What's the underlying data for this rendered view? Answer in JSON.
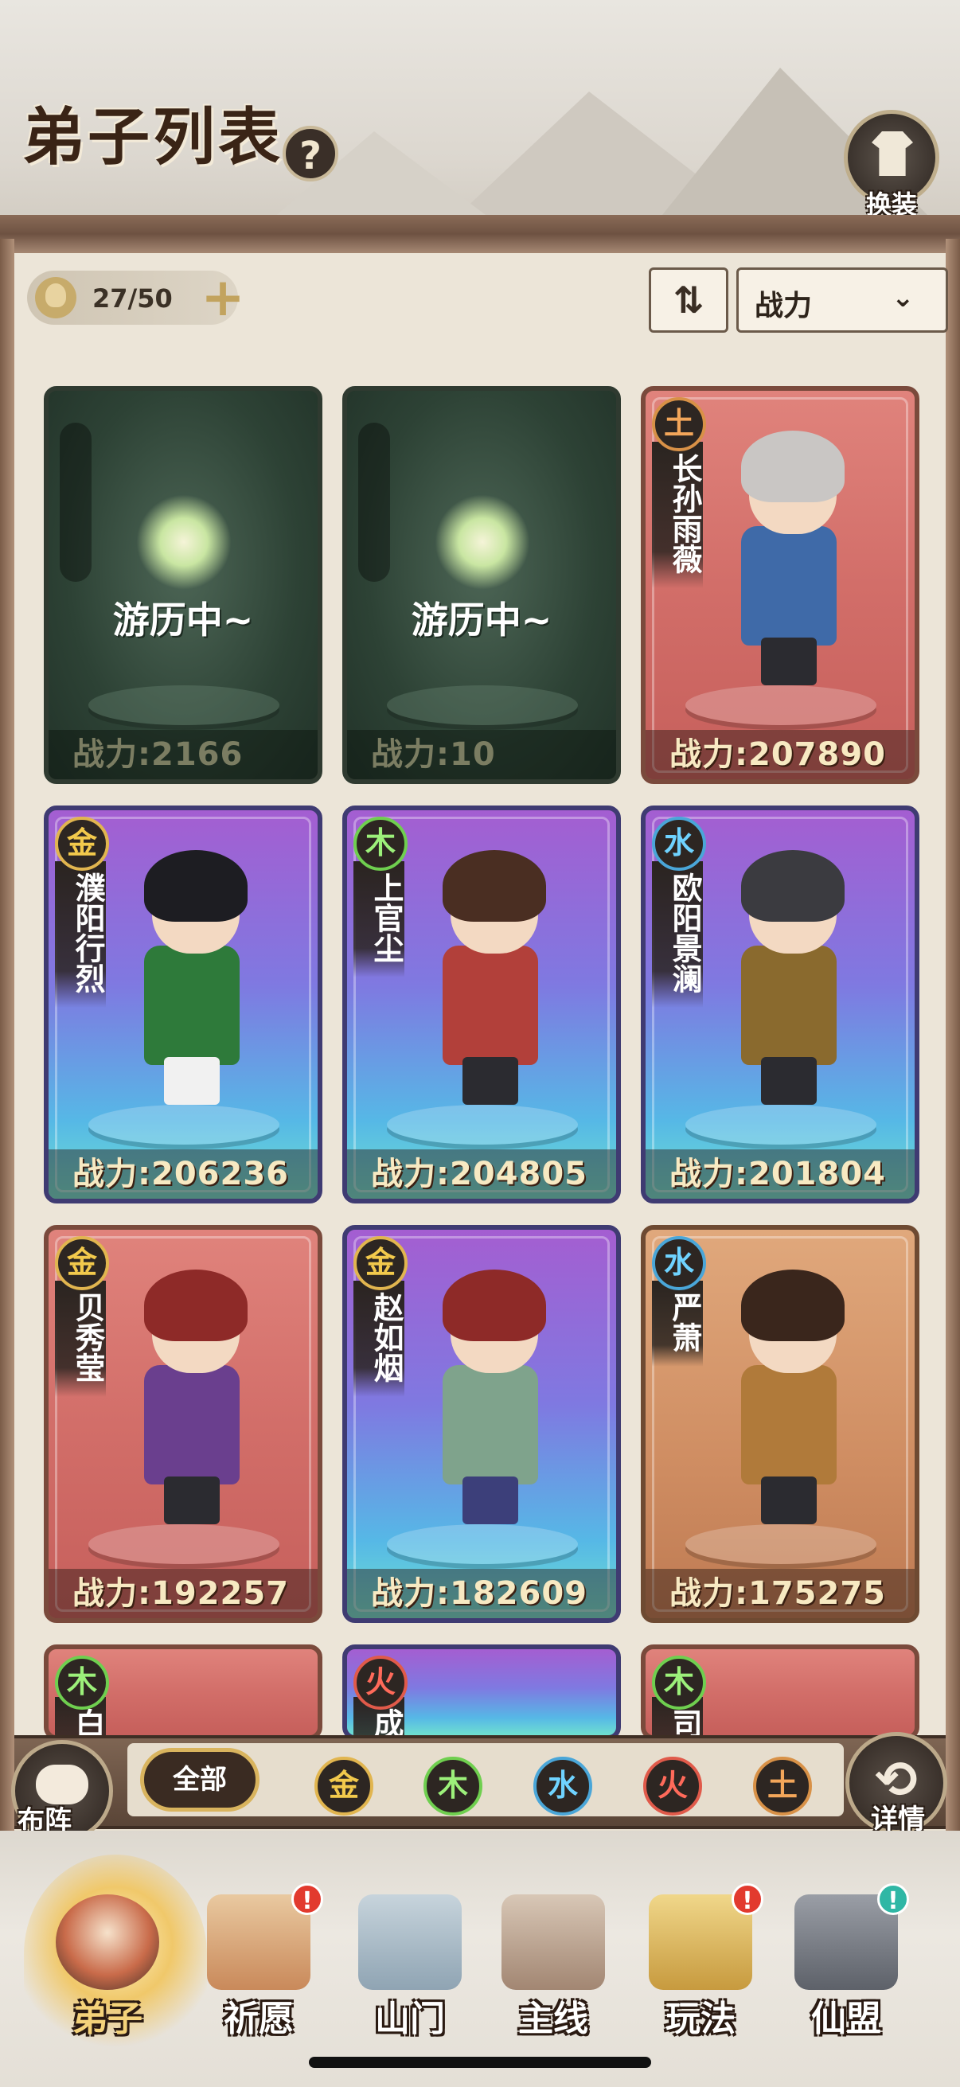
{
  "header": {
    "title": "弟子列表",
    "help_symbol": "?",
    "equip_label": "换装"
  },
  "toolbar": {
    "count": "27/50",
    "add_symbol": "+",
    "sort_symbol": "⇅",
    "sort_value": "战力",
    "sort_chevron": "⌄"
  },
  "cards": [
    {
      "type": "exploring",
      "status": "游历中~",
      "power": "战力:2166"
    },
    {
      "type": "exploring",
      "status": "游历中~",
      "power": "战力:10"
    },
    {
      "type": "disciple",
      "element": "土",
      "name": "长孙雨薇",
      "power": "战力:207890"
    },
    {
      "type": "disciple",
      "element": "金",
      "name": "濮阳行烈",
      "power": "战力:206236"
    },
    {
      "type": "disciple",
      "element": "木",
      "name": "上官尘",
      "power": "战力:204805"
    },
    {
      "type": "disciple",
      "element": "水",
      "name": "欧阳景澜",
      "power": "战力:201804"
    },
    {
      "type": "disciple",
      "element": "金",
      "name": "贝秀莹",
      "power": "战力:192257"
    },
    {
      "type": "disciple",
      "element": "金",
      "name": "赵如烟",
      "power": "战力:182609"
    },
    {
      "type": "disciple",
      "element": "水",
      "name": "严萧",
      "power": "战力:175275"
    },
    {
      "type": "disciple",
      "element": "木",
      "name": "白"
    },
    {
      "type": "disciple",
      "element": "火",
      "name": "成"
    },
    {
      "type": "disciple",
      "element": "木",
      "name": "司"
    }
  ],
  "filters": {
    "all": "全部",
    "elements": [
      "金",
      "木",
      "水",
      "火",
      "土"
    ]
  },
  "side_buttons": {
    "formation": "布阵",
    "details": "详情"
  },
  "nav": [
    {
      "label": "弟子",
      "active": true
    },
    {
      "label": "祈愿",
      "badge": "!"
    },
    {
      "label": "山门"
    },
    {
      "label": "主线"
    },
    {
      "label": "玩法",
      "badge": "!"
    },
    {
      "label": "仙盟",
      "badge": "!"
    }
  ],
  "colors": {
    "metal": "#f2c94c",
    "wood": "#9cf07a",
    "water": "#6fd3ff",
    "fire": "#ff6a5a",
    "earth": "#f3a65a"
  }
}
